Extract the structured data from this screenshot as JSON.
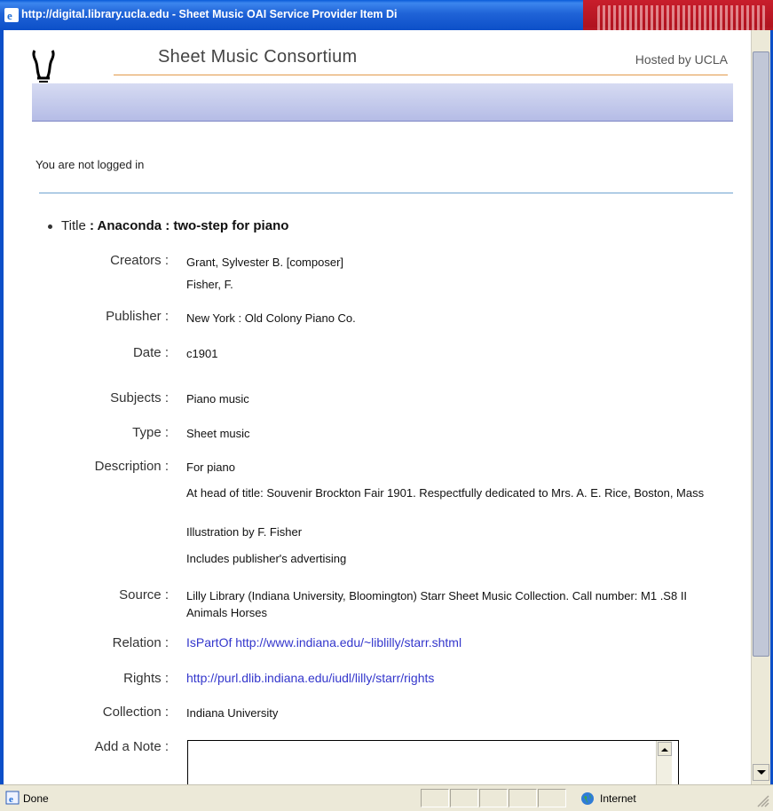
{
  "window": {
    "title": "http://digital.library.ucla.edu - Sheet Music OAI Service Provider Item Di"
  },
  "header": {
    "site_title": "Sheet Music Consortium",
    "hosted_by": "Hosted by UCLA"
  },
  "login_status": "You are not logged in",
  "item": {
    "title_label": "Title",
    "title_value": ": Anaconda : two-step for piano",
    "fields": [
      {
        "label": "Creators :",
        "values": [
          "Grant, Sylvester B. [composer]",
          "Fisher, F."
        ]
      },
      {
        "label": "Publisher :",
        "values": [
          "New York : Old Colony Piano Co."
        ]
      },
      {
        "label": "Date :",
        "values": [
          "c1901"
        ]
      },
      {
        "label": "Subjects :",
        "values": [
          "Piano music"
        ]
      },
      {
        "label": "Type :",
        "values": [
          "Sheet music"
        ]
      },
      {
        "label": "Description :",
        "values": [
          "For piano",
          "At head of title: Souvenir Brockton Fair 1901. Respectfully dedicated to Mrs. A. E. Rice, Boston, Mass",
          "Illustration by F. Fisher",
          "Includes publisher's advertising"
        ]
      },
      {
        "label": "Source :",
        "values": [
          "Lilly Library (Indiana University, Bloomington) Starr Sheet Music Collection. Call number: M1 .S8 II Animals Horses"
        ]
      },
      {
        "label": "Relation :",
        "values": [
          "IsPartOf http://www.indiana.edu/~liblilly/starr.shtml"
        ]
      },
      {
        "label": "Rights :",
        "values": [
          "http://purl.dlib.indiana.edu/iudl/lilly/starr/rights"
        ]
      },
      {
        "label": "Collection :",
        "values": [
          "Indiana University"
        ]
      },
      {
        "label": "Add a Note :"
      }
    ]
  },
  "statusbar": {
    "status": "Done",
    "zone": "Internet"
  },
  "colors": {
    "titlebar": "#0c4fc8",
    "link": "#3336cc",
    "nav_band": "#b5bce6",
    "orange_rule": "#e29a4a",
    "blue_rule": "#6fa2cf"
  }
}
